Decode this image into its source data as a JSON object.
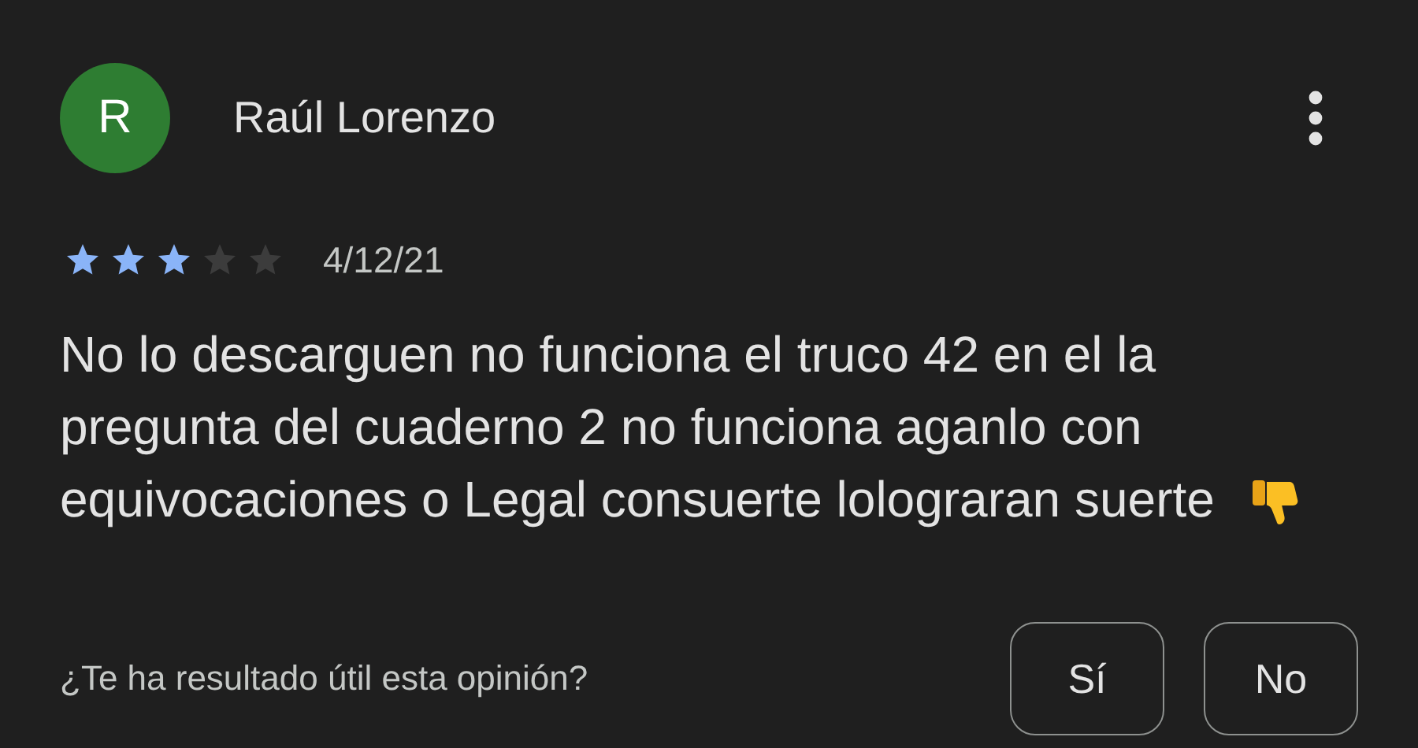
{
  "review": {
    "avatar_letter": "R",
    "author": "Raúl Lorenzo",
    "stars": 3,
    "date": "4/12/21",
    "text": "No lo descarguen no funciona el truco 42 en el la pregunta del cuaderno 2 no funciona aganlo con equivocaciones o Legal consuerte lolograran suerte"
  },
  "feedback": {
    "question": "¿Te ha resultado útil esta opinión?",
    "buttons": [
      "Sí",
      "No"
    ]
  }
}
